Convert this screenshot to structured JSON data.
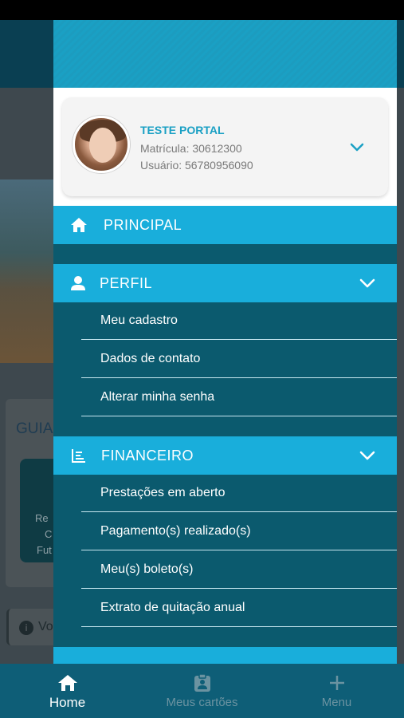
{
  "profile": {
    "name": "TESTE PORTAL",
    "matricula": "Matrícula: 30612300",
    "usuario": "Usuário: 56780956090"
  },
  "menu": {
    "principal": "PRINCIPAL",
    "perfil": {
      "label": "PERFIL",
      "items": [
        "Meu cadastro",
        "Dados de contato",
        "Alterar minha senha"
      ]
    },
    "financeiro": {
      "label": "FINANCEIRO",
      "items": [
        "Prestações em aberto",
        "Pagamento(s) realizado(s)",
        "Meu(s) boleto(s)",
        "Extrato de quitação anual"
      ]
    }
  },
  "background": {
    "card_title": "GUIA",
    "tile_text": [
      "Re",
      "C",
      "Fut"
    ],
    "info_text": "Vo"
  },
  "tabbar": {
    "home": "Home",
    "cards": "Meus cartões",
    "menu": "Menu"
  },
  "colors": {
    "accent": "#19aedb",
    "drawer_bg": "#0b5a6e",
    "tabbar_bg": "#0e5e77",
    "name_color": "#1aa0c4"
  }
}
